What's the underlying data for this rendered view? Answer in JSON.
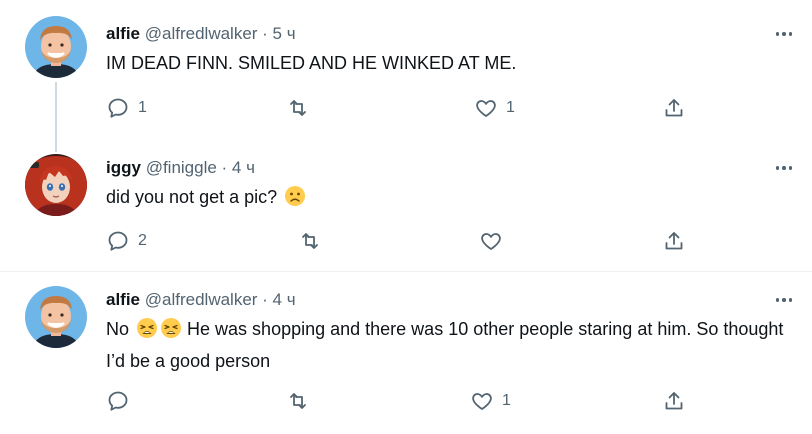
{
  "tweets": [
    {
      "display_name": "alfie",
      "handle": "@alfredlwalker",
      "time": " · 5 ч",
      "text": "IM DEAD FINN. SMILED AND HE WINKED AT ME.",
      "reply_count": "1",
      "retweet_count": "",
      "like_count": "1"
    },
    {
      "display_name": "iggy",
      "handle": "@finiggle",
      "time": " · 4 ч",
      "text": "did you not get a pic?",
      "reply_count": "2",
      "retweet_count": "",
      "like_count": ""
    },
    {
      "display_name": "alfie",
      "handle": "@alfredlwalker",
      "time": " · 4 ч",
      "text_prefix": "No",
      "text": " He was shopping and there was 10 other people staring at him. So thought I’d be a good person",
      "reply_count": "",
      "retweet_count": "",
      "like_count": "1"
    }
  ],
  "icons": {
    "reply": "reply-icon",
    "retweet": "retweet-icon",
    "like": "heart-icon",
    "share": "share-icon",
    "more": "more-icon",
    "emoji_sad": "frowning-face-emoji",
    "emoji_weary": "weary-face-emoji"
  },
  "colors": {
    "text": "#0f1419",
    "secondary": "#536471",
    "thread_line": "#cfd9de"
  }
}
